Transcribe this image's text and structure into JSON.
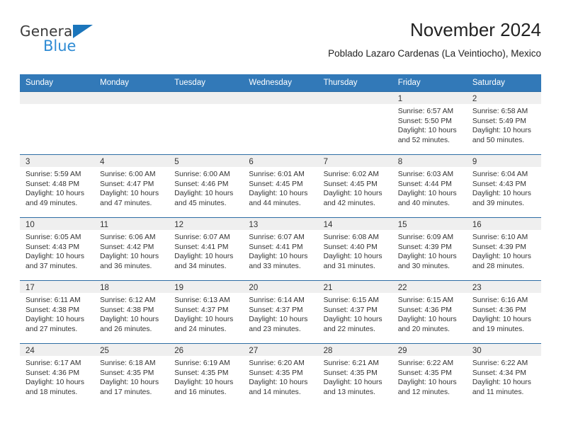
{
  "brand": {
    "name_top": "General",
    "name_bottom": "Blue",
    "accent_blue": "#1b75bb",
    "light_blue": "#2e8bd4"
  },
  "header": {
    "title": "November 2024",
    "subtitle": "Poblado Lazaro Cardenas (La Veintiocho), Mexico"
  },
  "theme": {
    "header_row_bg": "#3279b8",
    "week_divider": "#2e6da4",
    "day_band_bg": "#efefef"
  },
  "weekdays": [
    "Sunday",
    "Monday",
    "Tuesday",
    "Wednesday",
    "Thursday",
    "Friday",
    "Saturday"
  ],
  "weeks": [
    [
      {
        "day": "",
        "empty": true,
        "lines": []
      },
      {
        "day": "",
        "empty": true,
        "lines": []
      },
      {
        "day": "",
        "empty": true,
        "lines": []
      },
      {
        "day": "",
        "empty": true,
        "lines": []
      },
      {
        "day": "",
        "empty": true,
        "lines": []
      },
      {
        "day": "1",
        "empty": false,
        "lines": [
          "Sunrise: 6:57 AM",
          "Sunset: 5:50 PM",
          "Daylight: 10 hours",
          "and 52 minutes."
        ]
      },
      {
        "day": "2",
        "empty": false,
        "lines": [
          "Sunrise: 6:58 AM",
          "Sunset: 5:49 PM",
          "Daylight: 10 hours",
          "and 50 minutes."
        ]
      }
    ],
    [
      {
        "day": "3",
        "empty": false,
        "lines": [
          "Sunrise: 5:59 AM",
          "Sunset: 4:48 PM",
          "Daylight: 10 hours",
          "and 49 minutes."
        ]
      },
      {
        "day": "4",
        "empty": false,
        "lines": [
          "Sunrise: 6:00 AM",
          "Sunset: 4:47 PM",
          "Daylight: 10 hours",
          "and 47 minutes."
        ]
      },
      {
        "day": "5",
        "empty": false,
        "lines": [
          "Sunrise: 6:00 AM",
          "Sunset: 4:46 PM",
          "Daylight: 10 hours",
          "and 45 minutes."
        ]
      },
      {
        "day": "6",
        "empty": false,
        "lines": [
          "Sunrise: 6:01 AM",
          "Sunset: 4:45 PM",
          "Daylight: 10 hours",
          "and 44 minutes."
        ]
      },
      {
        "day": "7",
        "empty": false,
        "lines": [
          "Sunrise: 6:02 AM",
          "Sunset: 4:45 PM",
          "Daylight: 10 hours",
          "and 42 minutes."
        ]
      },
      {
        "day": "8",
        "empty": false,
        "lines": [
          "Sunrise: 6:03 AM",
          "Sunset: 4:44 PM",
          "Daylight: 10 hours",
          "and 40 minutes."
        ]
      },
      {
        "day": "9",
        "empty": false,
        "lines": [
          "Sunrise: 6:04 AM",
          "Sunset: 4:43 PM",
          "Daylight: 10 hours",
          "and 39 minutes."
        ]
      }
    ],
    [
      {
        "day": "10",
        "empty": false,
        "lines": [
          "Sunrise: 6:05 AM",
          "Sunset: 4:43 PM",
          "Daylight: 10 hours",
          "and 37 minutes."
        ]
      },
      {
        "day": "11",
        "empty": false,
        "lines": [
          "Sunrise: 6:06 AM",
          "Sunset: 4:42 PM",
          "Daylight: 10 hours",
          "and 36 minutes."
        ]
      },
      {
        "day": "12",
        "empty": false,
        "lines": [
          "Sunrise: 6:07 AM",
          "Sunset: 4:41 PM",
          "Daylight: 10 hours",
          "and 34 minutes."
        ]
      },
      {
        "day": "13",
        "empty": false,
        "lines": [
          "Sunrise: 6:07 AM",
          "Sunset: 4:41 PM",
          "Daylight: 10 hours",
          "and 33 minutes."
        ]
      },
      {
        "day": "14",
        "empty": false,
        "lines": [
          "Sunrise: 6:08 AM",
          "Sunset: 4:40 PM",
          "Daylight: 10 hours",
          "and 31 minutes."
        ]
      },
      {
        "day": "15",
        "empty": false,
        "lines": [
          "Sunrise: 6:09 AM",
          "Sunset: 4:39 PM",
          "Daylight: 10 hours",
          "and 30 minutes."
        ]
      },
      {
        "day": "16",
        "empty": false,
        "lines": [
          "Sunrise: 6:10 AM",
          "Sunset: 4:39 PM",
          "Daylight: 10 hours",
          "and 28 minutes."
        ]
      }
    ],
    [
      {
        "day": "17",
        "empty": false,
        "lines": [
          "Sunrise: 6:11 AM",
          "Sunset: 4:38 PM",
          "Daylight: 10 hours",
          "and 27 minutes."
        ]
      },
      {
        "day": "18",
        "empty": false,
        "lines": [
          "Sunrise: 6:12 AM",
          "Sunset: 4:38 PM",
          "Daylight: 10 hours",
          "and 26 minutes."
        ]
      },
      {
        "day": "19",
        "empty": false,
        "lines": [
          "Sunrise: 6:13 AM",
          "Sunset: 4:37 PM",
          "Daylight: 10 hours",
          "and 24 minutes."
        ]
      },
      {
        "day": "20",
        "empty": false,
        "lines": [
          "Sunrise: 6:14 AM",
          "Sunset: 4:37 PM",
          "Daylight: 10 hours",
          "and 23 minutes."
        ]
      },
      {
        "day": "21",
        "empty": false,
        "lines": [
          "Sunrise: 6:15 AM",
          "Sunset: 4:37 PM",
          "Daylight: 10 hours",
          "and 22 minutes."
        ]
      },
      {
        "day": "22",
        "empty": false,
        "lines": [
          "Sunrise: 6:15 AM",
          "Sunset: 4:36 PM",
          "Daylight: 10 hours",
          "and 20 minutes."
        ]
      },
      {
        "day": "23",
        "empty": false,
        "lines": [
          "Sunrise: 6:16 AM",
          "Sunset: 4:36 PM",
          "Daylight: 10 hours",
          "and 19 minutes."
        ]
      }
    ],
    [
      {
        "day": "24",
        "empty": false,
        "lines": [
          "Sunrise: 6:17 AM",
          "Sunset: 4:36 PM",
          "Daylight: 10 hours",
          "and 18 minutes."
        ]
      },
      {
        "day": "25",
        "empty": false,
        "lines": [
          "Sunrise: 6:18 AM",
          "Sunset: 4:35 PM",
          "Daylight: 10 hours",
          "and 17 minutes."
        ]
      },
      {
        "day": "26",
        "empty": false,
        "lines": [
          "Sunrise: 6:19 AM",
          "Sunset: 4:35 PM",
          "Daylight: 10 hours",
          "and 16 minutes."
        ]
      },
      {
        "day": "27",
        "empty": false,
        "lines": [
          "Sunrise: 6:20 AM",
          "Sunset: 4:35 PM",
          "Daylight: 10 hours",
          "and 14 minutes."
        ]
      },
      {
        "day": "28",
        "empty": false,
        "lines": [
          "Sunrise: 6:21 AM",
          "Sunset: 4:35 PM",
          "Daylight: 10 hours",
          "and 13 minutes."
        ]
      },
      {
        "day": "29",
        "empty": false,
        "lines": [
          "Sunrise: 6:22 AM",
          "Sunset: 4:35 PM",
          "Daylight: 10 hours",
          "and 12 minutes."
        ]
      },
      {
        "day": "30",
        "empty": false,
        "lines": [
          "Sunrise: 6:22 AM",
          "Sunset: 4:34 PM",
          "Daylight: 10 hours",
          "and 11 minutes."
        ]
      }
    ]
  ]
}
